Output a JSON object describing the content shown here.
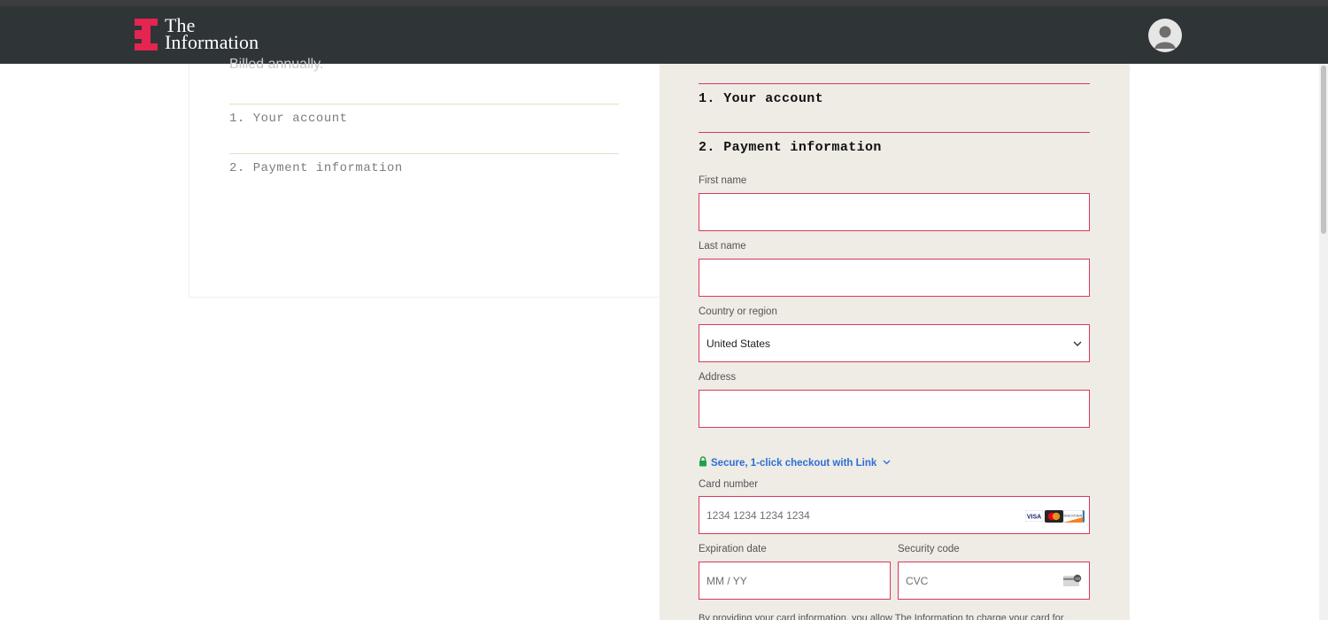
{
  "header": {
    "logo_line1": "The",
    "logo_line2": "Information",
    "brand_color": "#e4254f"
  },
  "summary": {
    "billed": "Billed annually.",
    "steps": [
      "1. Your account",
      "2. Payment information"
    ]
  },
  "form": {
    "step1": "1. Your account",
    "step2": "2. Payment information",
    "first_name_label": "First name",
    "last_name_label": "Last name",
    "country_label": "Country or region",
    "country_value": "United States",
    "address_label": "Address",
    "link_text": "Secure, 1-click checkout with Link",
    "card_label": "Card number",
    "card_placeholder": "1234 1234 1234 1234",
    "card_brands": [
      "VISA",
      "Mastercard",
      "Amex",
      "Discover"
    ],
    "expiry_label": "Expiration date",
    "expiry_placeholder": "MM / YY",
    "cvc_label": "Security code",
    "cvc_placeholder": "CVC",
    "footer_cut": "By providing your card information, you allow The Information to charge your card for"
  }
}
